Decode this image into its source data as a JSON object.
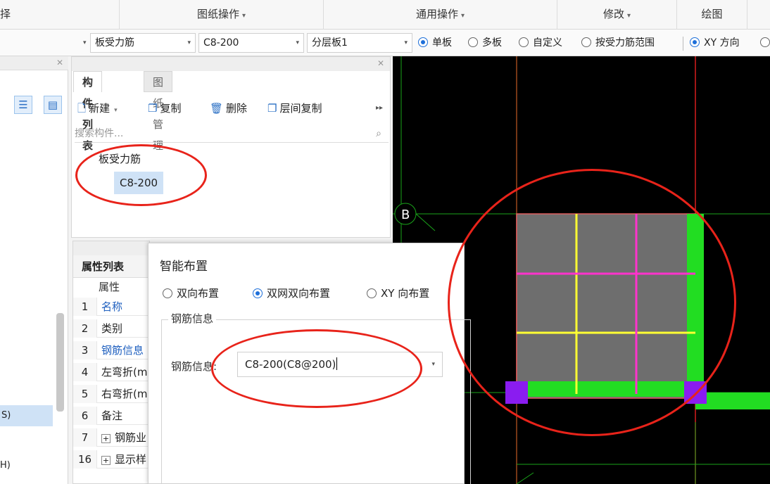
{
  "ribbon": {
    "groups": [
      {
        "label": "择",
        "has_arrow": false
      },
      {
        "label": "图纸操作",
        "has_arrow": true
      },
      {
        "label": "通用操作",
        "has_arrow": true
      },
      {
        "label": "修改",
        "has_arrow": true
      },
      {
        "label": "绘图",
        "has_arrow": false
      }
    ]
  },
  "property_toolbar": {
    "combo1_value": "板受力筋",
    "combo2_value": "C8-200",
    "combo3_value": "分层板1",
    "radios": [
      {
        "label": "单板",
        "selected": true
      },
      {
        "label": "多板",
        "selected": false
      },
      {
        "label": "自定义",
        "selected": false
      },
      {
        "label": "按受力筋范围",
        "selected": false
      }
    ],
    "direction_radios": [
      {
        "label": "XY 方向",
        "selected": true
      }
    ]
  },
  "left_panel": {
    "selected_item": "S)",
    "item2": "H)"
  },
  "component_panel": {
    "tabs": [
      "构件列表",
      "图纸管理"
    ],
    "active_tab": "构件列表",
    "toolbar": {
      "new_label": "新建",
      "copy_label": "复制",
      "delete_label": "删除",
      "floor_copy_label": "层间复制"
    },
    "search_placeholder": "搜索构件...",
    "tree": {
      "parent": "板受力筋",
      "child": "C8-200"
    }
  },
  "attribute_panel": {
    "title": "属性列表",
    "column_header": "属性",
    "rows": [
      {
        "num": "1",
        "name": "名称",
        "blue": true,
        "expand": false
      },
      {
        "num": "2",
        "name": "类别",
        "blue": false,
        "expand": false
      },
      {
        "num": "3",
        "name": "钢筋信息",
        "blue": true,
        "expand": false
      },
      {
        "num": "4",
        "name": "左弯折(m",
        "blue": false,
        "expand": false
      },
      {
        "num": "5",
        "name": "右弯折(m",
        "blue": false,
        "expand": false
      },
      {
        "num": "6",
        "name": "备注",
        "blue": false,
        "expand": false
      },
      {
        "num": "7",
        "name": "钢筋业",
        "blue": false,
        "expand": true
      },
      {
        "num": "16",
        "name": "显示样",
        "blue": false,
        "expand": true
      }
    ]
  },
  "dialog": {
    "title": "智能布置",
    "layout_options": [
      {
        "label": "双向布置",
        "selected": false
      },
      {
        "label": "双网双向布置",
        "selected": true
      },
      {
        "label": "XY 向布置",
        "selected": false
      }
    ],
    "group_label": "钢筋信息",
    "field_label": "钢筋信息:",
    "field_value": "C8-200(C8@200)"
  },
  "canvas": {
    "axis_label": "B",
    "colors": {
      "background": "#000000",
      "grid_red": "#d81e1e",
      "grid_green": "#1aa51a",
      "slab_fill": "#6e6e6e",
      "bar_yellow": "#ffff33",
      "bar_magenta": "#ff33cc",
      "bar_green": "#22dd22",
      "support_purple": "#8a1cf0"
    }
  },
  "annotation_color": "#e8231a"
}
